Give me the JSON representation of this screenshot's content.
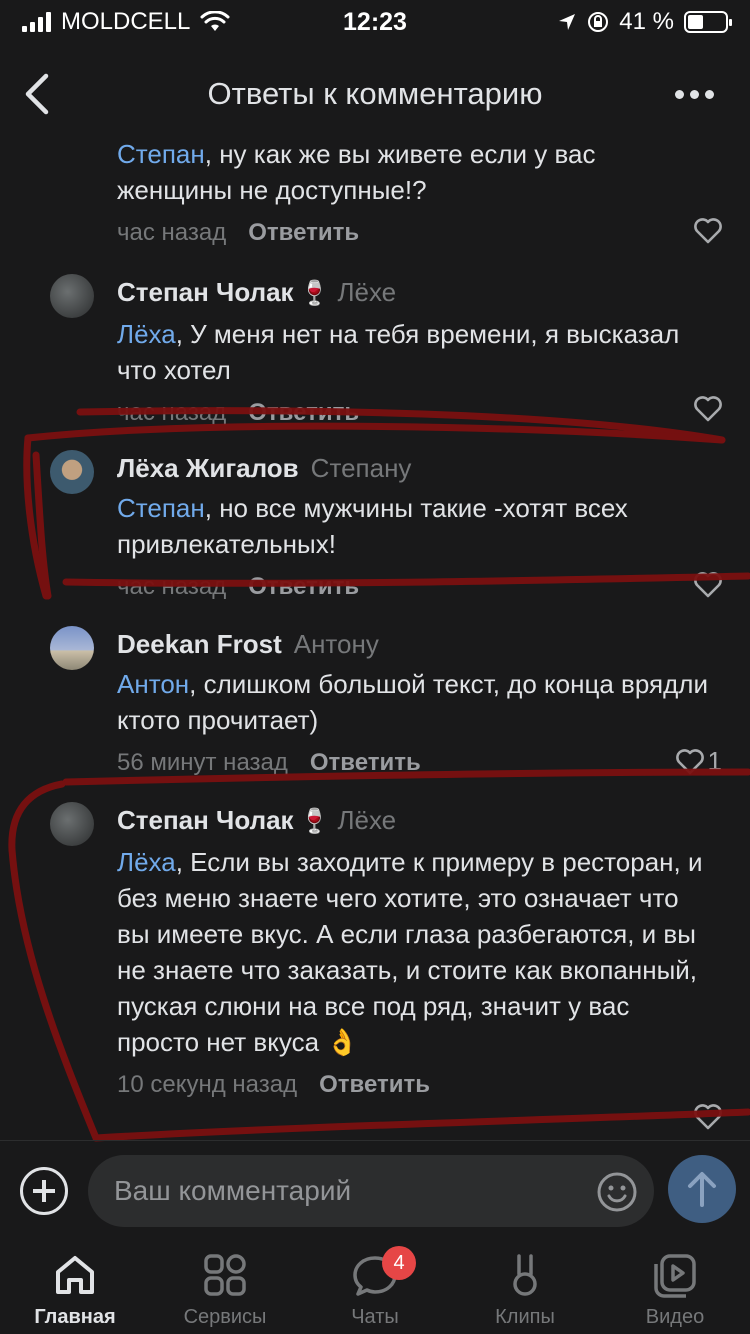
{
  "status_bar": {
    "carrier": "MOLDCELL",
    "time": "12:23",
    "battery_percent": "41 %",
    "battery_level": 0.41
  },
  "header": {
    "title": "Ответы к комментарию",
    "back_icon": "chevron-left-icon",
    "menu_icon": "more-horizontal-icon"
  },
  "comments": [
    {
      "author": "",
      "mention": "Степан",
      "text": ", ну как же вы живете если у вас женщины не доступные!?",
      "time": "час назад",
      "reply_label": "Ответить",
      "likes": ""
    },
    {
      "author": "Степан Чолак",
      "emoji": "🍷",
      "reply_to": "Лёхе",
      "mention": "Лёха",
      "text": ", У меня нет на тебя времени, я высказал что хотел",
      "time": "час назад",
      "reply_label": "Ответить",
      "likes": ""
    },
    {
      "author": "Лёха Жигалов",
      "reply_to": "Степану",
      "mention": "Степан",
      "text": ", но все мужчины такие -хотят всех привлекательных!",
      "time": "час назад",
      "reply_label": "Ответить",
      "likes": ""
    },
    {
      "author": "Deekan Frost",
      "reply_to": "Антону",
      "mention": "Антон",
      "text": ", слишком большой текст, до конца врядли ктото прочитает)",
      "time": "56 минут назад",
      "reply_label": "Ответить",
      "likes": "1"
    },
    {
      "author": "Степан Чолак",
      "emoji": "🍷",
      "reply_to": "Лёхе",
      "mention": "Лёха",
      "text": ", Если вы заходите к примеру в ресторан, и без меню знаете чего хотите, это означает что вы имеете вкус. А если глаза разбегаются, и вы не знаете что заказать, и стоите как вкопанный, пуская слюни на все под ряд, значит у вас просто нет вкуса 👌",
      "time": "10 секунд назад",
      "reply_label": "Ответить",
      "likes": ""
    }
  ],
  "input": {
    "placeholder": "Ваш комментарий"
  },
  "tabs": [
    {
      "label": "Главная",
      "icon": "home-icon",
      "active": true
    },
    {
      "label": "Сервисы",
      "icon": "services-icon"
    },
    {
      "label": "Чаты",
      "icon": "chat-icon",
      "badge": "4"
    },
    {
      "label": "Клипы",
      "icon": "clips-icon"
    },
    {
      "label": "Видео",
      "icon": "video-icon"
    }
  ],
  "colors": {
    "background": "#19191a",
    "mention": "#71aaeb",
    "secondary_text": "#76787a",
    "marker": "#7a1010",
    "badge": "#e64646"
  }
}
